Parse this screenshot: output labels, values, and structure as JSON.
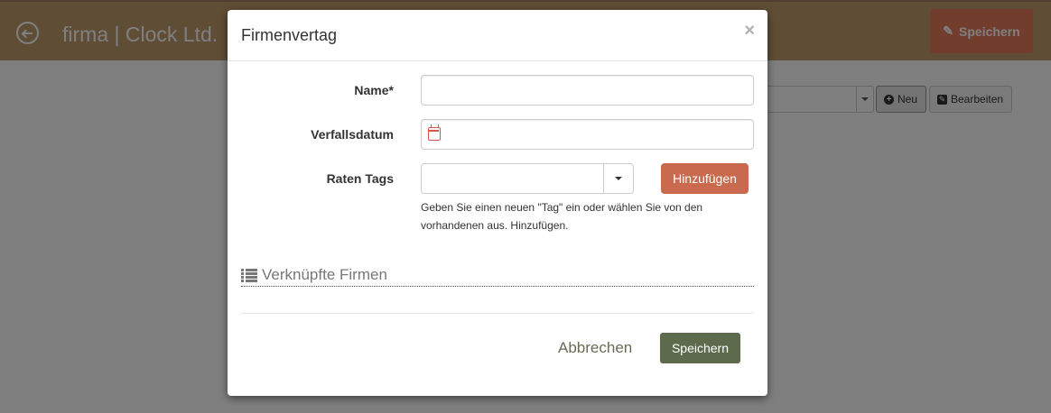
{
  "background": {
    "page_title": "firma | Clock Ltd.",
    "top_save_label": "Speichern",
    "new_button_label": "Neu",
    "edit_button_label": "Bearbeiten"
  },
  "modal": {
    "title": "Firmenvertag",
    "close_symbol": "×",
    "fields": {
      "name": {
        "label": "Name*",
        "value": ""
      },
      "expiry": {
        "label": "Verfallsdatum",
        "value": ""
      },
      "tags": {
        "label": "Raten Tags",
        "value": ""
      }
    },
    "add_button_label": "Hinzufügen",
    "help_text": "Geben Sie einen neuen \"Tag\" ein oder wählen Sie von den vorhandenen aus. Hinzufügen.",
    "section_title": "Verknüpfte Firmen",
    "cancel_label": "Abbrechen",
    "save_label": "Speichern"
  },
  "icons": {
    "back": "back-arrow-circle-icon",
    "pencil": "pencil-icon",
    "plus": "plus-circle-icon",
    "edit": "edit-square-icon",
    "calendar": "calendar-icon",
    "caret": "caret-down-icon",
    "list": "list-icon",
    "close": "close-icon"
  },
  "colors": {
    "topbar": "#bf9a6d",
    "accent_orange": "#c96a4f",
    "save_green": "#5d6b4c"
  }
}
